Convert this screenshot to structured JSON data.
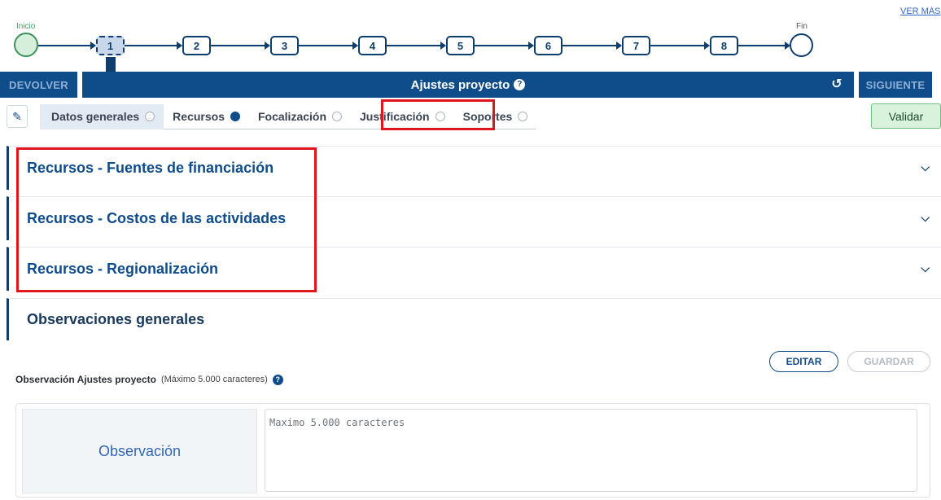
{
  "header": {
    "ver_link": "VER MÁS",
    "stepper": {
      "start_label": "Inicio",
      "end_label": "Fin",
      "steps": [
        "1",
        "2",
        "3",
        "4",
        "5",
        "6",
        "7",
        "8"
      ],
      "active_step": "1"
    }
  },
  "title_bar": {
    "back_label": "DEVOLVER",
    "title": "Ajustes proyecto",
    "next_label": "SIGUIENTE",
    "help_icon": "question-circle-icon",
    "history_icon": "history-icon"
  },
  "tabs": {
    "items": [
      {
        "label": "Datos generales",
        "state": "empty"
      },
      {
        "label": "Recursos",
        "state": "filled"
      },
      {
        "label": "Focalización",
        "state": "empty"
      },
      {
        "label": "Justificación",
        "state": "empty"
      },
      {
        "label": "Soportes",
        "state": "empty"
      }
    ],
    "validate_label": "Validar",
    "edit_icon": "pencil-icon"
  },
  "sections": [
    {
      "title": "Recursos - Fuentes de financiación"
    },
    {
      "title": "Recursos - Costos de las actividades"
    },
    {
      "title": "Recursos - Regionalización"
    }
  ],
  "observations": {
    "section_title": "Observaciones generales",
    "edit_label": "EDITAR",
    "save_label": "GUARDAR",
    "field_label": "Observación Ajustes proyecto",
    "field_hint": "(Máximo 5.000 caracteres)",
    "row_label": "Observación",
    "placeholder": "Maximo 5.000 caracteres"
  },
  "colors": {
    "primary": "#0f4c8a",
    "highlight": "#e0161e",
    "validate_bg": "#d8f2dc"
  }
}
